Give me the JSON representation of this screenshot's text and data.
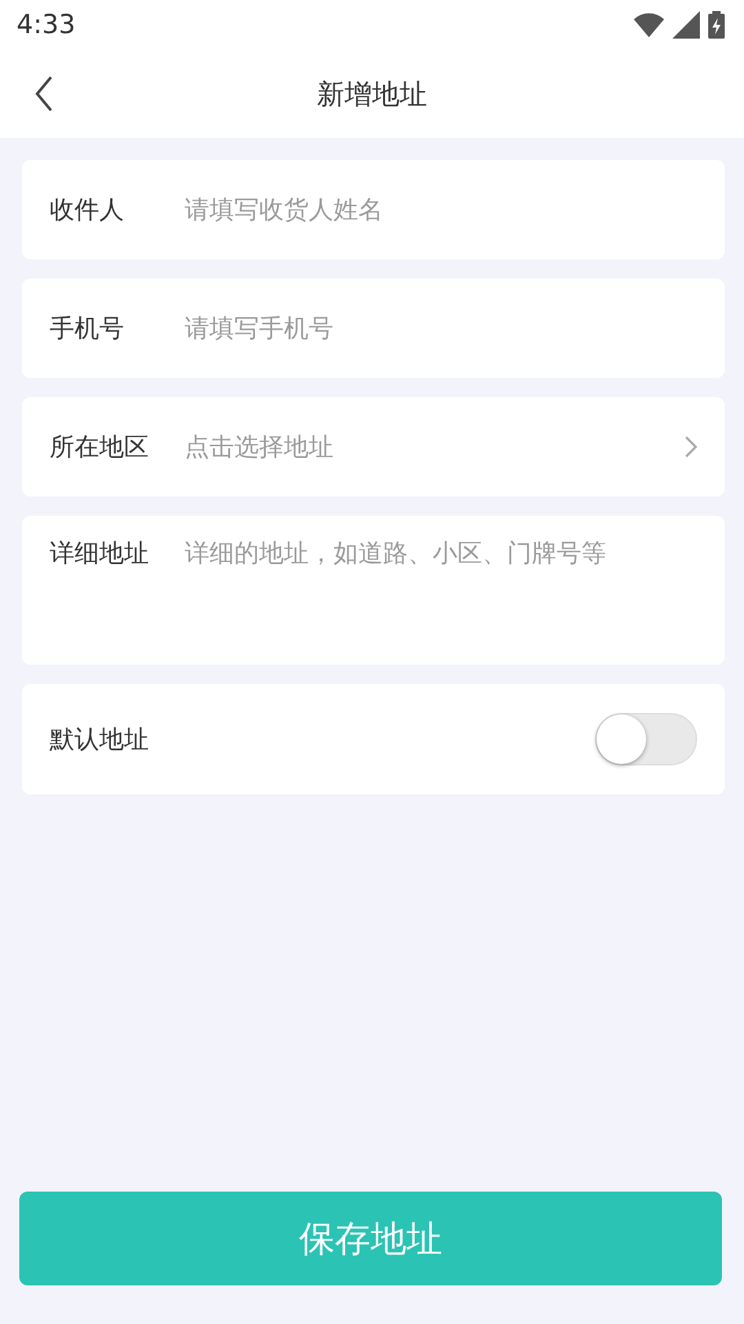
{
  "status_bar": {
    "time": "4:33"
  },
  "header": {
    "title": "新增地址"
  },
  "fields": [
    {
      "kind": "input",
      "label": "收件人",
      "placeholder": "请填写收货人姓名"
    },
    {
      "kind": "input",
      "label": "手机号",
      "placeholder": "请填写手机号"
    },
    {
      "kind": "select",
      "label": "所在地区",
      "placeholder": "点击选择地址"
    },
    {
      "kind": "textarea",
      "label": "详细地址",
      "placeholder": "详细的地址，如道路、小区、门牌号等"
    }
  ],
  "default_address": {
    "label": "默认地址",
    "on": false
  },
  "save_button": {
    "label": "保存地址"
  }
}
